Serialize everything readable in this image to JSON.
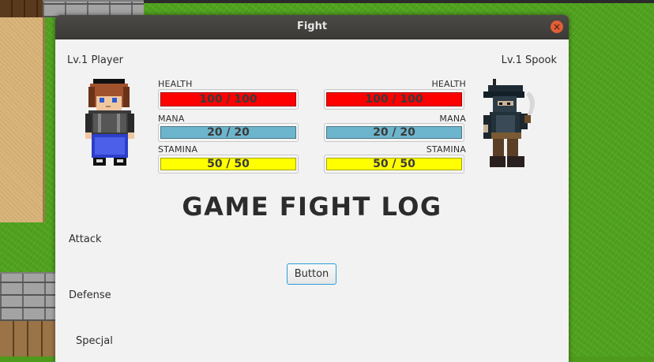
{
  "window": {
    "title": "Fight"
  },
  "player": {
    "name": "Lv.1 Player",
    "health_label": "HEALTH",
    "health": "100 / 100",
    "mana_label": "MANA",
    "mana": "20 / 20",
    "stamina_label": "STAMINA",
    "stamina": "50 / 50"
  },
  "enemy": {
    "name": "Lv.1 Spook",
    "health_label": "HEALTH",
    "health": "100 / 100",
    "mana_label": "MANA",
    "mana": "20 / 20",
    "stamina_label": "STAMINA",
    "stamina": "50 / 50"
  },
  "log_title": "GAME FIGHT LOG",
  "actions": {
    "attack": "Attack",
    "defense": "Defense",
    "special": "Specjal"
  },
  "button_label": "Button",
  "colors": {
    "health": "#ff0000",
    "mana": "#6db5cc",
    "stamina": "#ffff00",
    "button_focus": "#2c9fd9"
  }
}
